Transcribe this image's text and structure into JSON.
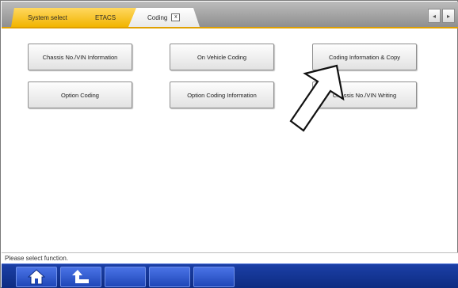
{
  "tabs": {
    "system_select": "System select",
    "etacs": "ETACS",
    "coding": "Coding",
    "close_glyph": "x"
  },
  "nav": {
    "prev_glyph": "◂",
    "next_glyph": "▸"
  },
  "buttons": {
    "chassis_vin_info": "Chassis No./VIN Information",
    "on_vehicle_coding": "On Vehicle Coding",
    "coding_info_copy": "Coding Information & Copy",
    "option_coding": "Option Coding",
    "option_coding_info": "Option Coding Information",
    "chassis_vin_writing": "Chassis No./VIN Writing"
  },
  "status": {
    "message": "Please select function."
  },
  "toolbar": {
    "home_icon": "home-icon",
    "back_icon": "back-arrow-icon"
  },
  "colors": {
    "tab_active": "#f1b400",
    "toolbar_blue": "#1b3fa6",
    "underline": "#e0a000"
  }
}
